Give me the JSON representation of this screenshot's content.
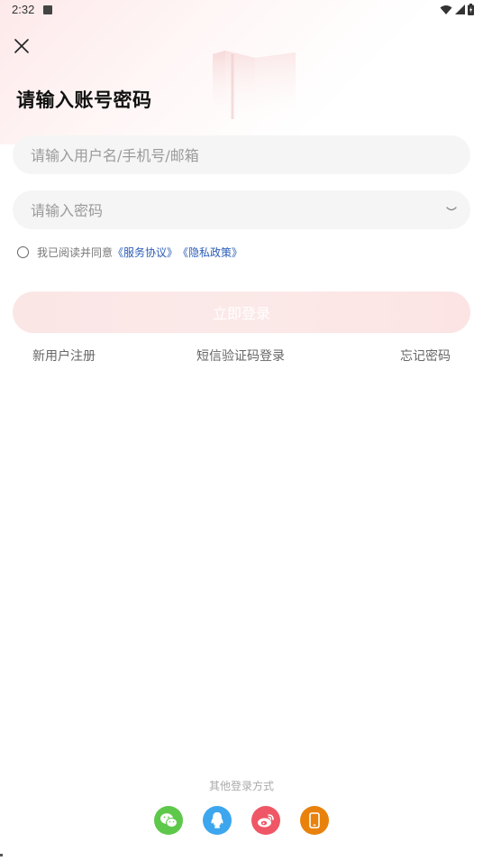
{
  "status_bar": {
    "time": "2:32"
  },
  "title": "请输入账号密码",
  "username": {
    "placeholder": "请输入用户名/手机号/邮箱",
    "value": ""
  },
  "password": {
    "placeholder": "请输入密码",
    "value": ""
  },
  "agreement": {
    "prefix": "我已阅读并同意",
    "service_link": "《服务协议》",
    "privacy_link": "《隐私政策》",
    "checked": false
  },
  "login_button": "立即登录",
  "links": {
    "register": "新用户注册",
    "sms_login": "短信验证码登录",
    "forgot_password": "忘记密码"
  },
  "other_login": {
    "label": "其他登录方式",
    "methods": [
      "wechat-icon",
      "qq-icon",
      "weibo-icon",
      "phone-icon"
    ]
  },
  "colors": {
    "wechat": "#5ec84a",
    "qq": "#3da6ef",
    "weibo": "#ef5766",
    "phone": "#e8820c",
    "link": "#2b5cb8",
    "login_button": "#fbe6e6"
  }
}
